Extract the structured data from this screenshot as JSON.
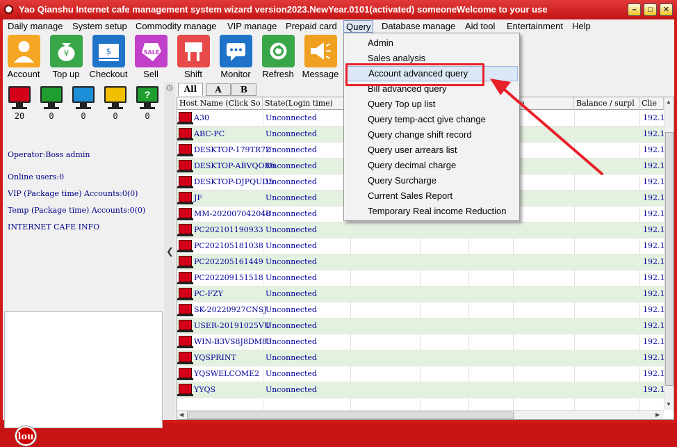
{
  "window": {
    "title": "Yao Qianshu Internet cafe management system wizard version2023.NewYear.0101(activated)   someoneWelcome to your use",
    "min_glyph": "–",
    "max_glyph": "□",
    "close_glyph": "✕"
  },
  "menu": [
    "Daily manage",
    "System setup",
    "Commodity manage",
    "VIP manage",
    "Prepaid card",
    "Query",
    "Database manage",
    "Aid tool",
    "Entertainment",
    "Help"
  ],
  "toolbar": [
    {
      "label": "Account",
      "icon": "account-icon",
      "color": "#f5a623"
    },
    {
      "label": "Top up",
      "icon": "topup-icon",
      "color": "#3aa64a"
    },
    {
      "label": "Checkout",
      "icon": "checkout-icon",
      "color": "#1f73c9"
    },
    {
      "label": "Sell",
      "icon": "sell-icon",
      "color": "#c23fc9"
    },
    {
      "label": "Shift",
      "icon": "shift-icon",
      "color": "#e84a4a"
    },
    {
      "label": "Monitor",
      "icon": "monitor-icon",
      "color": "#1f73c9"
    },
    {
      "label": "Refresh",
      "icon": "refresh-icon",
      "color": "#3aa64a"
    },
    {
      "label": "Message",
      "icon": "message-icon",
      "color": "#f0a020"
    }
  ],
  "status_monitors": [
    {
      "color": "#d4001a",
      "count": "20"
    },
    {
      "color": "#1e9e2e",
      "count": "0"
    },
    {
      "color": "#1d8ed8",
      "count": "0"
    },
    {
      "color": "#f2c000",
      "count": "0"
    },
    {
      "color": "#1e9e2e",
      "count": "0",
      "glyph": "?"
    }
  ],
  "info": {
    "operator": "Operator:Boss admin",
    "online": "Online users:0",
    "vip": "VIP (Package time) Accounts:0(0)",
    "temp": "Temp (Package time) Accounts:0(0)",
    "cafe_info": "INTERNET CAFE  INFO"
  },
  "badge": "lou",
  "tabs": [
    "All",
    "A",
    "B"
  ],
  "columns": [
    "Host Name (Click So",
    "State(Login time)",
    "",
    "",
    "line",
    "Balance / surpl",
    "Clie"
  ],
  "rows": [
    {
      "host": "A30",
      "state": "Unconnected",
      "ip": "192.1"
    },
    {
      "host": "ABC-PC",
      "state": "Unconnected",
      "ip": "192.1"
    },
    {
      "host": "DESKTOP-179TR72",
      "state": "Unconnected",
      "ip": "192.1"
    },
    {
      "host": "DESKTOP-ABVQOR6",
      "state": "Unconnected",
      "ip": "192.1"
    },
    {
      "host": "DESKTOP-DJPQUD5",
      "state": "Unconnected",
      "ip": "192.1"
    },
    {
      "host": "JF",
      "state": "Unconnected",
      "ip": "192.1"
    },
    {
      "host": "MM-202007042048",
      "state": "Unconnected",
      "ip": "192.1"
    },
    {
      "host": "PC202101190933",
      "state": "Unconnected",
      "ip": "192.1"
    },
    {
      "host": "PC202105181038",
      "state": "Unconnected",
      "ip": "192.1"
    },
    {
      "host": "PC202205161449",
      "state": "Unconnected",
      "ip": "192.1"
    },
    {
      "host": "PC202209151518",
      "state": "Unconnected",
      "ip": "192.1"
    },
    {
      "host": "PC-FZY",
      "state": "Unconnected",
      "ip": "192.1"
    },
    {
      "host": "SK-20220927CNSJ",
      "state": "Unconnected",
      "ip": "192.1"
    },
    {
      "host": "USER-20191025VU",
      "state": "Unconnected",
      "ip": "192.1"
    },
    {
      "host": "WIN-B3VS8J8DM83",
      "state": "Unconnected",
      "ip": "192.1"
    },
    {
      "host": "YQSPRINT",
      "state": "Unconnected",
      "ip": "192.1"
    },
    {
      "host": "YQSWELCOME2",
      "state": "Unconnected",
      "ip": "192.1"
    },
    {
      "host": "YYQS",
      "state": "Unconnected",
      "ip": "192.1"
    }
  ],
  "query_menu": [
    "Admin",
    "Sales analysis",
    "Account advanced query",
    "Bill advanced query",
    "Query Top up list",
    "Query temp-acct give change",
    "Query change shift record",
    "Query user arrears list",
    "Query decimal charge",
    "Query Surcharge",
    "Current Sales Report",
    "Temporary Real income Reduction"
  ],
  "highlighted_item": "Account advanced query",
  "annotation_color": "#e8202a"
}
